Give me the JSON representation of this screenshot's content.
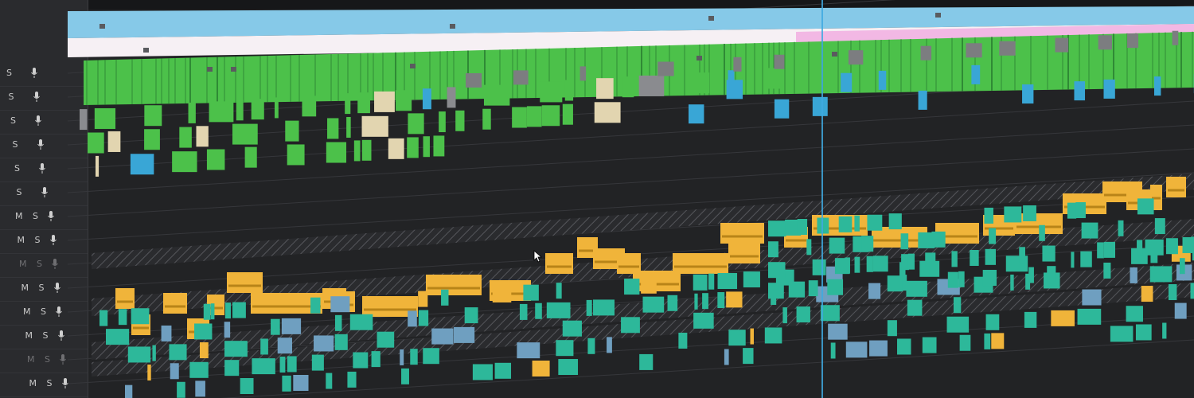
{
  "app": "video-editor-timeline",
  "colors": {
    "video_clip_green": "#4cc14a",
    "audio_clip_orange": "#f0b43a",
    "audio_clip_teal": "#2db89a",
    "clip_blue": "#39a6d6",
    "clip_beige": "#e2d5b0",
    "top_band_blue": "#86c9e8",
    "top_band_pink": "#f2b8e4",
    "playhead": "#3fa9e0",
    "track_bg": "#1f2022"
  },
  "track_headers": [
    {
      "mute": "",
      "solo": "S",
      "mic": "mic-icon"
    },
    {
      "mute": "",
      "solo": "S",
      "mic": "mic-icon"
    },
    {
      "mute": "",
      "solo": "S",
      "mic": "mic-icon"
    },
    {
      "mute": "",
      "solo": "S",
      "mic": "mic-icon"
    },
    {
      "mute": "",
      "solo": "S",
      "mic": "mic-icon"
    },
    {
      "mute": "",
      "solo": "S",
      "mic": "mic-icon"
    },
    {
      "mute": "M",
      "solo": "S",
      "mic": "mic-icon"
    },
    {
      "mute": "M",
      "solo": "S",
      "mic": "mic-icon"
    },
    {
      "mute": "M",
      "solo": "S",
      "mic": "mic-icon"
    },
    {
      "mute": "M",
      "solo": "S",
      "mic": "mic-icon"
    },
    {
      "mute": "M",
      "solo": "S",
      "mic": "mic-icon"
    },
    {
      "mute": "M",
      "solo": "S",
      "mic": "mic-icon"
    },
    {
      "mute": "M",
      "solo": "S",
      "mic": "mic-icon"
    },
    {
      "mute": "M",
      "solo": "S",
      "mic": "mic-icon"
    }
  ]
}
